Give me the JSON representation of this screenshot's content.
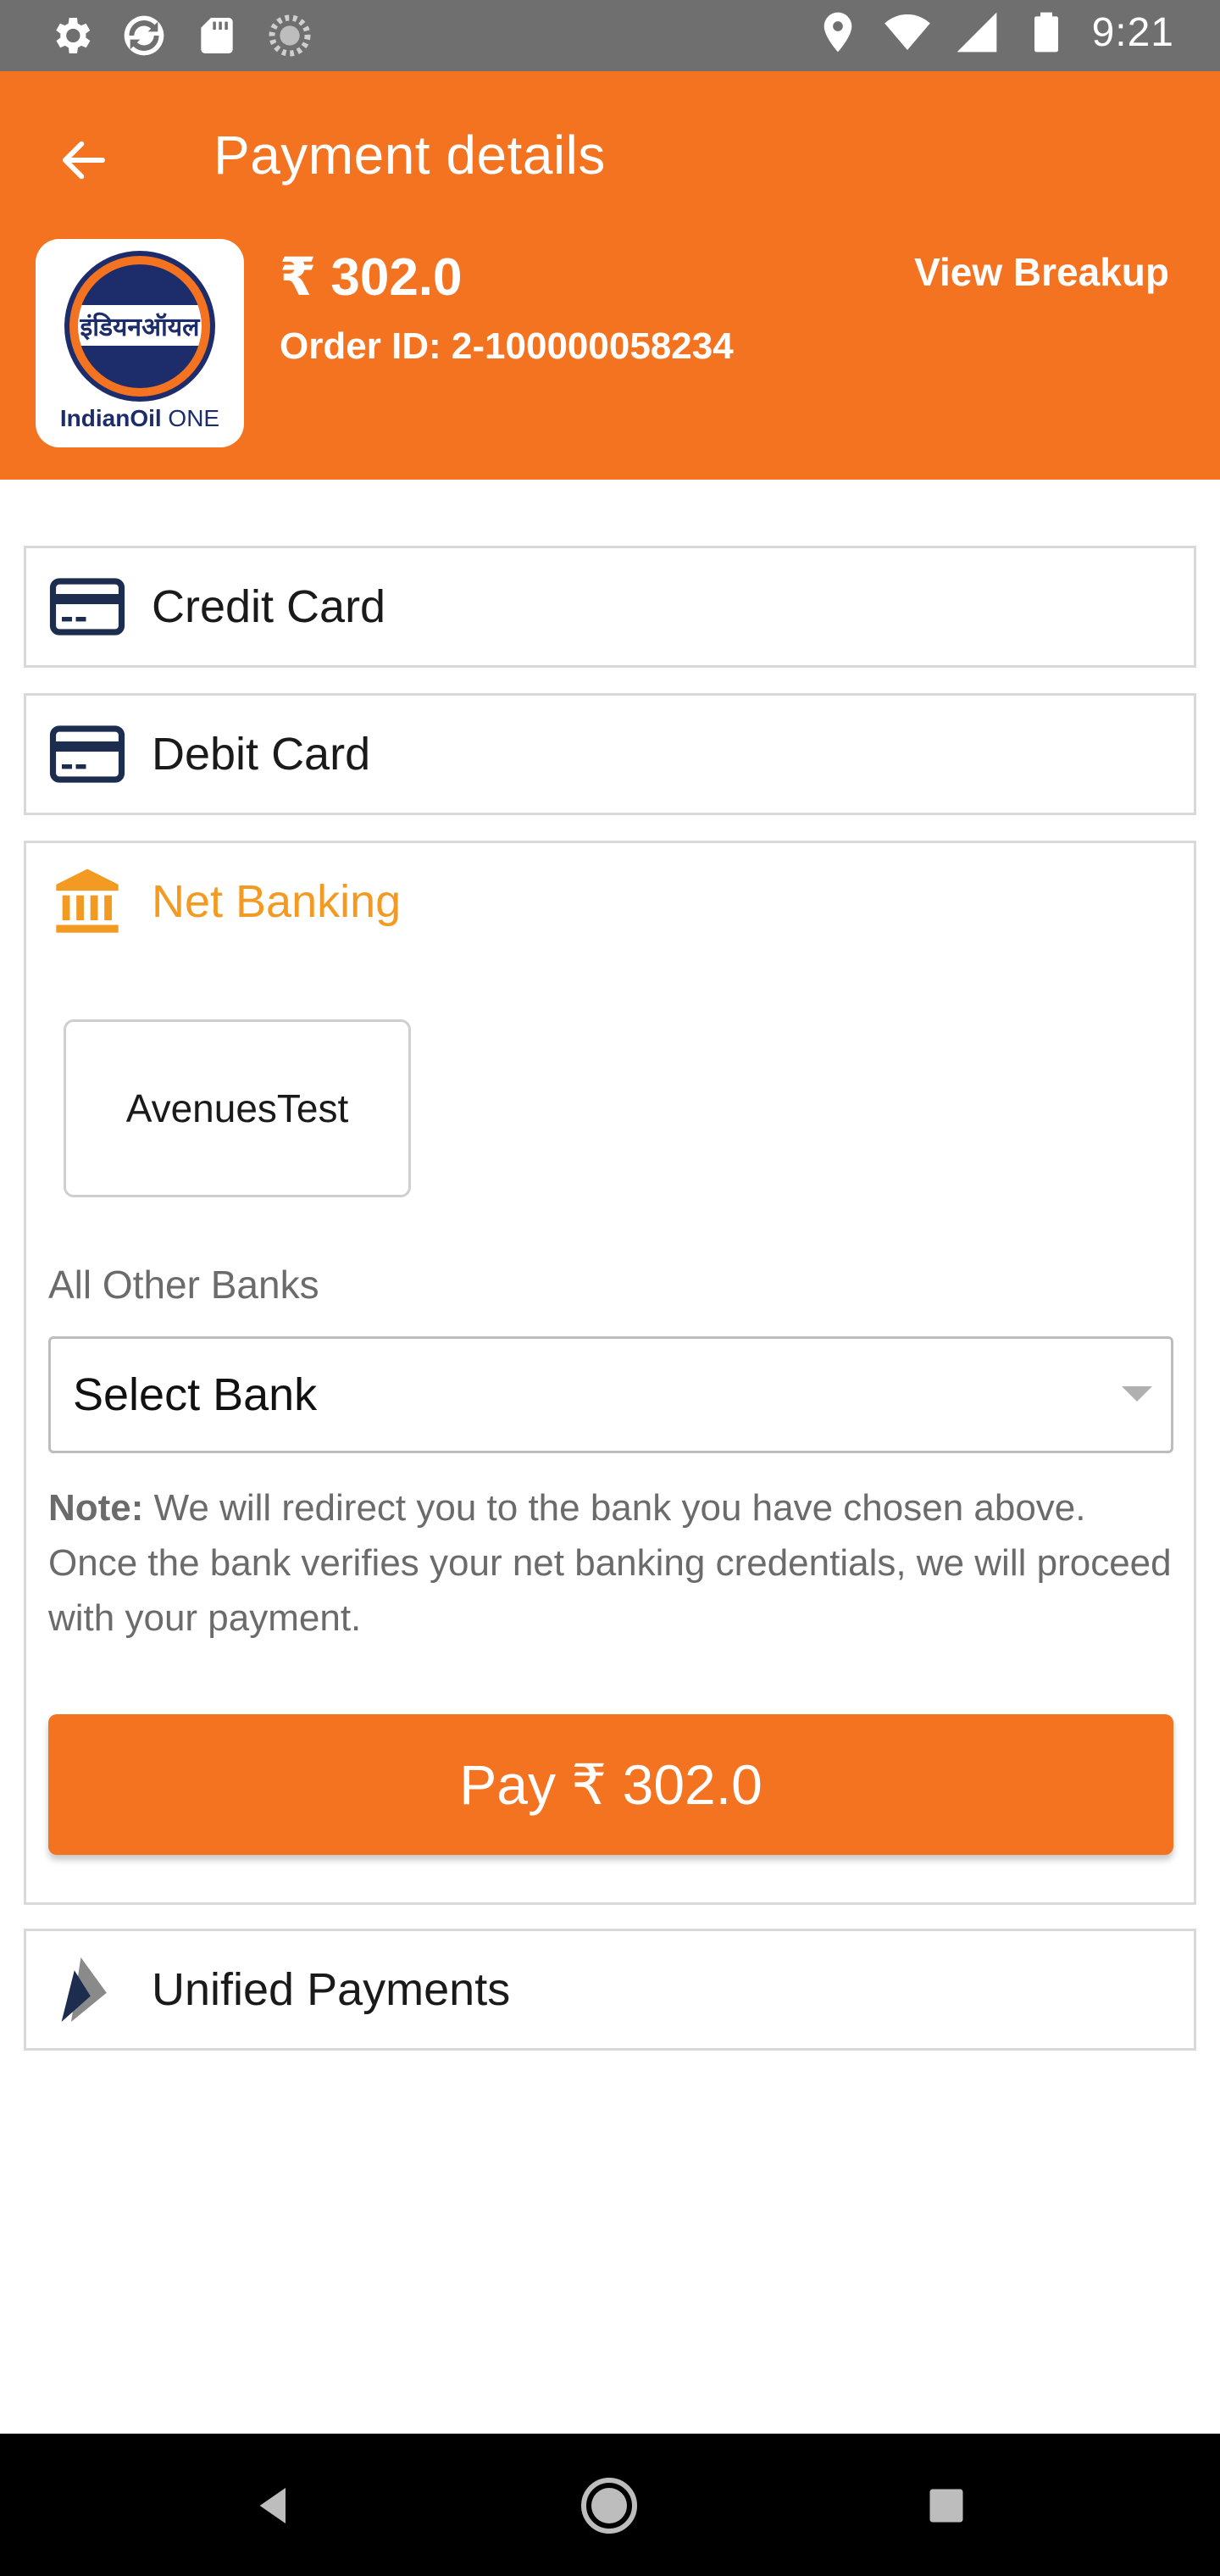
{
  "status_bar": {
    "time": "9:21",
    "left_icons": [
      "settings-icon",
      "sync-icon",
      "sd-card-icon",
      "loading-icon"
    ],
    "right_icons": [
      "location-icon",
      "wifi-icon",
      "signal-icon",
      "battery-icon"
    ]
  },
  "header": {
    "title": "Payment details",
    "amount": "₹ 302.0",
    "order_id": "Order ID:  2-100000058234",
    "view_breakup_label": "View Breakup",
    "logo": {
      "hindi_text": "इंडियनऑयल",
      "brand_bold": "IndianOil",
      "brand_light": " ONE"
    }
  },
  "payment_options": {
    "credit_card": {
      "label": "Credit Card",
      "icon": "credit-card-icon"
    },
    "debit_card": {
      "label": "Debit Card",
      "icon": "debit-card-icon"
    },
    "net_banking": {
      "label": "Net Banking",
      "icon": "bank-icon",
      "bank_tile": "AvenuesTest",
      "other_banks_label": "All Other Banks",
      "select_bank_value": "Select Bank",
      "note_label": "Note:",
      "note_text": " We will redirect you to the bank you have chosen above. Once the bank verifies your net banking credentials, we will proceed with your payment.",
      "pay_button_label": "Pay ₹ 302.0"
    },
    "upi": {
      "label": "Unified Payments",
      "icon": "upi-icon"
    }
  },
  "colors": {
    "brand_orange": "#f37321",
    "active_label": "#f39a23",
    "status_bar": "#6f6f6f",
    "nav_bar": "#000000"
  },
  "nav_bar": {
    "buttons": [
      "back-nav-icon",
      "home-nav-icon",
      "recents-nav-icon"
    ]
  }
}
